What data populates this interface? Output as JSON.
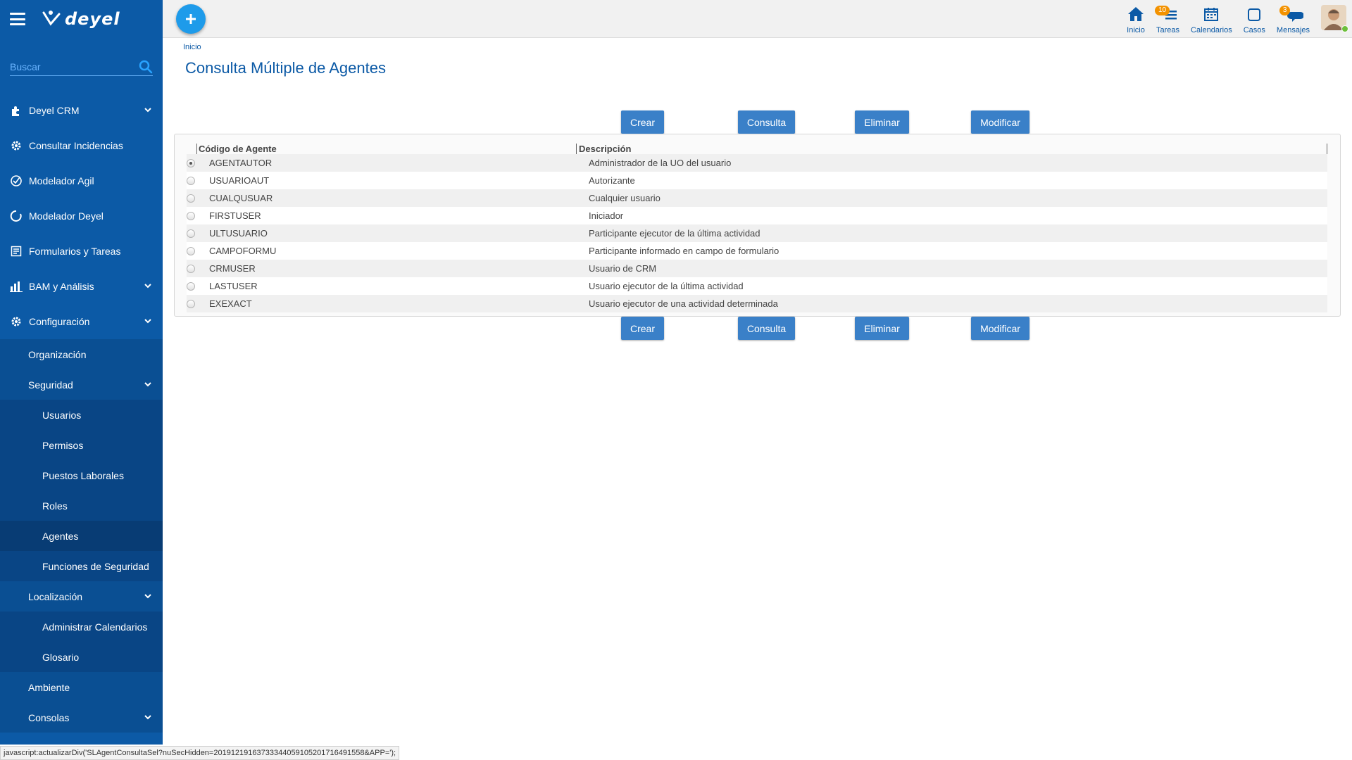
{
  "app": {
    "logo_text": "deyel"
  },
  "sidebar": {
    "search_placeholder": "Buscar",
    "items": [
      {
        "label": "Deyel CRM",
        "icon": "puzzle-icon",
        "chevron": true
      },
      {
        "label": "Consultar Incidencias",
        "icon": "gear-icon",
        "chevron": false
      },
      {
        "label": "Modelador Agil",
        "icon": "agile-modeler-icon",
        "chevron": false
      },
      {
        "label": "Modelador Deyel",
        "icon": "circle-arrow-icon",
        "chevron": false
      },
      {
        "label": "Formularios y Tareas",
        "icon": "form-icon",
        "chevron": false
      },
      {
        "label": "BAM y Análisis",
        "icon": "bar-chart-icon",
        "chevron": true
      },
      {
        "label": "Configuración",
        "icon": "gear-icon",
        "chevron": true
      }
    ],
    "config_children": {
      "organizacion": "Organización",
      "seguridad": "Seguridad",
      "seguridad_children": [
        "Usuarios",
        "Permisos",
        "Puestos Laborales",
        "Roles",
        "Agentes",
        "Funciones de Seguridad"
      ],
      "localizacion": "Localización",
      "localizacion_children": [
        "Administrar Calendarios",
        "Glosario"
      ],
      "ambiente": "Ambiente",
      "consolas": "Consolas"
    },
    "active_item": "Agentes"
  },
  "topbar": {
    "items": [
      {
        "label": "Inicio",
        "icon": "home-icon",
        "badge": ""
      },
      {
        "label": "Tareas",
        "icon": "tasks-icon",
        "badge": "10"
      },
      {
        "label": "Calendarios",
        "icon": "calendar-icon",
        "badge": ""
      },
      {
        "label": "Casos",
        "icon": "cases-icon",
        "badge": ""
      },
      {
        "label": "Mensajes",
        "icon": "chat-icon",
        "badge": "3"
      }
    ]
  },
  "main": {
    "breadcrumb": "Inicio",
    "title": "Consulta Múltiple de Agentes",
    "buttons": {
      "crear": "Crear",
      "consulta": "Consulta",
      "eliminar": "Eliminar",
      "modificar": "Modificar"
    },
    "grid": {
      "columns": [
        "Código de Agente",
        "Descripción"
      ],
      "rows": [
        {
          "code": "AGENTAUTOR",
          "desc": "Administrador de la UO del usuario",
          "selected": true
        },
        {
          "code": "USUARIOAUT",
          "desc": "Autorizante",
          "selected": false
        },
        {
          "code": "CUALQUSUAR",
          "desc": "Cualquier usuario",
          "selected": false
        },
        {
          "code": "FIRSTUSER",
          "desc": "Iniciador",
          "selected": false
        },
        {
          "code": "ULTUSUARIO",
          "desc": "Participante ejecutor de la última actividad",
          "selected": false
        },
        {
          "code": "CAMPOFORMU",
          "desc": "Participante informado en campo de formulario",
          "selected": false
        },
        {
          "code": "CRMUSER",
          "desc": "Usuario de CRM",
          "selected": false
        },
        {
          "code": "LASTUSER",
          "desc": "Usuario ejecutor de la última actividad",
          "selected": false
        },
        {
          "code": "EXEXACT",
          "desc": "Usuario ejecutor de una actividad determinada",
          "selected": false
        }
      ]
    }
  },
  "status_bar": "javascript:actualizarDiv('SLAgentConsultaSel?nuSecHidden=20191219163733344059105201716491558&APP=');",
  "colors": {
    "sidebar": "#0c5aa6",
    "accent": "#1e9bea",
    "button": "#3a80c8",
    "badge": "#f39200",
    "title": "#0c5aa6"
  }
}
